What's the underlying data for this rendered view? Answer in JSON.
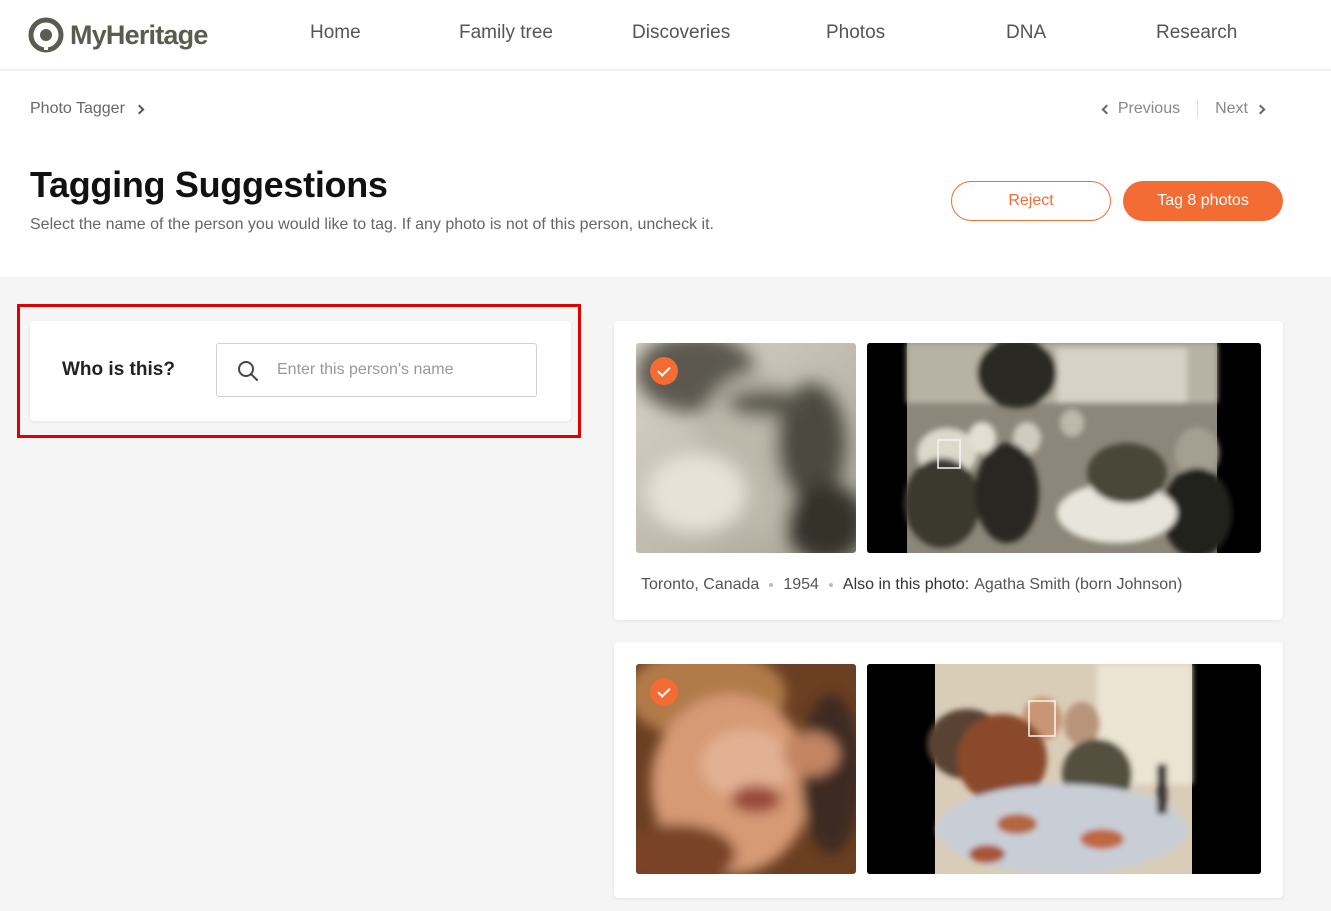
{
  "brand": {
    "name": "MyHeritage"
  },
  "nav": [
    "Home",
    "Family tree",
    "Discoveries",
    "Photos",
    "DNA",
    "Research"
  ],
  "breadcrumb": {
    "label": "Photo Tagger"
  },
  "pager": {
    "previous": "Previous",
    "next": "Next"
  },
  "page": {
    "title": "Tagging Suggestions",
    "subtitle": "Select the name of the person you would like to tag. If any photo is not of this person, uncheck it."
  },
  "actions": {
    "reject": "Reject",
    "tag": "Tag 8 photos"
  },
  "who": {
    "label": "Who is this?",
    "placeholder": "Enter this person's name",
    "value": ""
  },
  "suggestions": [
    {
      "checked": true,
      "location": "Toronto, Canada",
      "year": "1954",
      "also_label": "Also in this photo:",
      "also_names": "Agatha Smith (born Johnson)"
    },
    {
      "checked": true
    }
  ],
  "colors": {
    "accent": "#f26c33",
    "highlight": "#e00000"
  }
}
